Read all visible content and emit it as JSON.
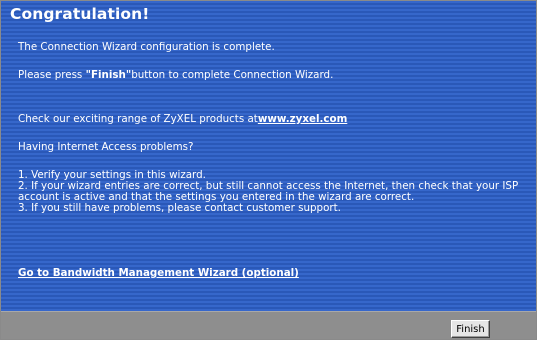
{
  "header": {
    "title": "Congratulation!"
  },
  "body": {
    "complete_text": "The Connection Wizard configuration is complete.",
    "press_prefix": "Please press ",
    "press_button_name": "\"Finish\"",
    "press_suffix": "button to complete Connection Wizard.",
    "products_prefix": "Check our exciting range of ZyXEL products at",
    "products_link": "www.zyxel.com",
    "problems_heading": "Having Internet Access problems?",
    "steps": [
      "1. Verify your settings in this wizard.",
      "2. If your wizard entries are correct, but still cannot access the Internet, then check that your ISP account is active and that the settings you entered in the wizard are correct.",
      "3. If you still have problems, please contact customer support."
    ],
    "bandwidth_link": "Go to Bandwidth Management Wizard (optional)"
  },
  "footer": {
    "finish_label": "Finish"
  },
  "colors": {
    "panel_background": "#2f62c7",
    "footer_background": "#8e8e8e",
    "text": "#ffffff"
  }
}
